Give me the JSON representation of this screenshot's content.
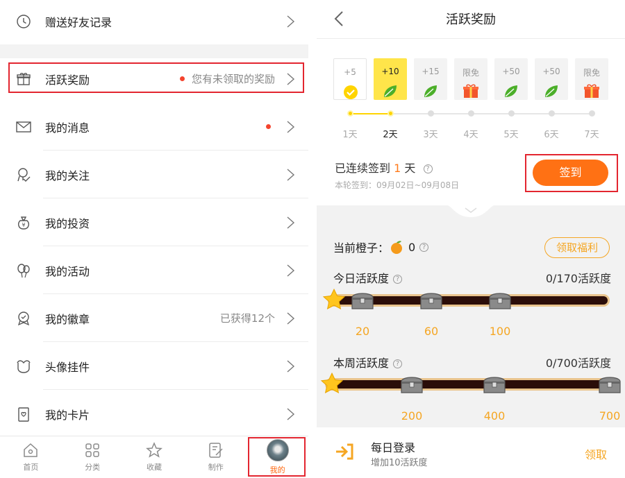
{
  "left": {
    "menu": [
      {
        "label": "赠送好友记录",
        "icon": "clock-icon",
        "value": "",
        "dot": false
      },
      {
        "label": "活跃奖励",
        "icon": "gift-icon",
        "value": "您有未领取的奖励",
        "dot": true
      },
      {
        "label": "我的消息",
        "icon": "envelope-icon",
        "value": "",
        "dot": true
      },
      {
        "label": "我的关注",
        "icon": "follow-icon",
        "value": "",
        "dot": false
      },
      {
        "label": "我的投资",
        "icon": "money-bag-icon",
        "value": "",
        "dot": false
      },
      {
        "label": "我的活动",
        "icon": "balloon-icon",
        "value": "",
        "dot": false
      },
      {
        "label": "我的徽章",
        "icon": "badge-icon",
        "value": "已获得12个",
        "dot": false
      },
      {
        "label": "头像挂件",
        "icon": "pendant-icon",
        "value": "",
        "dot": false
      },
      {
        "label": "我的卡片",
        "icon": "card-icon",
        "value": "",
        "dot": false
      }
    ],
    "tabs": [
      {
        "label": "首页",
        "icon": "home-icon"
      },
      {
        "label": "分类",
        "icon": "grid-icon"
      },
      {
        "label": "收藏",
        "icon": "star-icon"
      },
      {
        "label": "制作",
        "icon": "edit-icon"
      },
      {
        "label": "我的",
        "icon": "avatar"
      }
    ],
    "active_tab": "我的"
  },
  "right": {
    "title": "活跃奖励",
    "days": [
      {
        "value": "+5",
        "label": "1天",
        "reward": "check",
        "state": "done"
      },
      {
        "value": "+10",
        "label": "2天",
        "reward": "leaf",
        "state": "current"
      },
      {
        "value": "+15",
        "label": "3天",
        "reward": "leaf",
        "state": "future"
      },
      {
        "value": "限免",
        "label": "4天",
        "reward": "gift",
        "state": "future"
      },
      {
        "value": "+50",
        "label": "5天",
        "reward": "leaf",
        "state": "future"
      },
      {
        "value": "+50",
        "label": "6天",
        "reward": "leaf",
        "state": "future"
      },
      {
        "value": "限免",
        "label": "7天",
        "reward": "gift",
        "state": "future"
      }
    ],
    "streak_prefix": "已连续签到",
    "streak_days": "1",
    "streak_suffix": "天",
    "period": "本轮签到：09月02日~09月08日",
    "sign_button": "签到",
    "orange_label": "当前橙子：",
    "orange_count": "0",
    "welfare_button": "领取福利",
    "today": {
      "label": "今日活跃度",
      "value": "0/170活跃度",
      "milestones": [
        "20",
        "60",
        "100"
      ]
    },
    "week": {
      "label": "本周活跃度",
      "value": "0/700活跃度",
      "milestones": [
        "200",
        "400",
        "700"
      ]
    },
    "task": {
      "name": "每日登录",
      "desc": "增加10活跃度",
      "action": "领取"
    },
    "colors": {
      "accent": "#ff7114",
      "gold": "#f5a623",
      "highlight": "#e3252f"
    }
  }
}
